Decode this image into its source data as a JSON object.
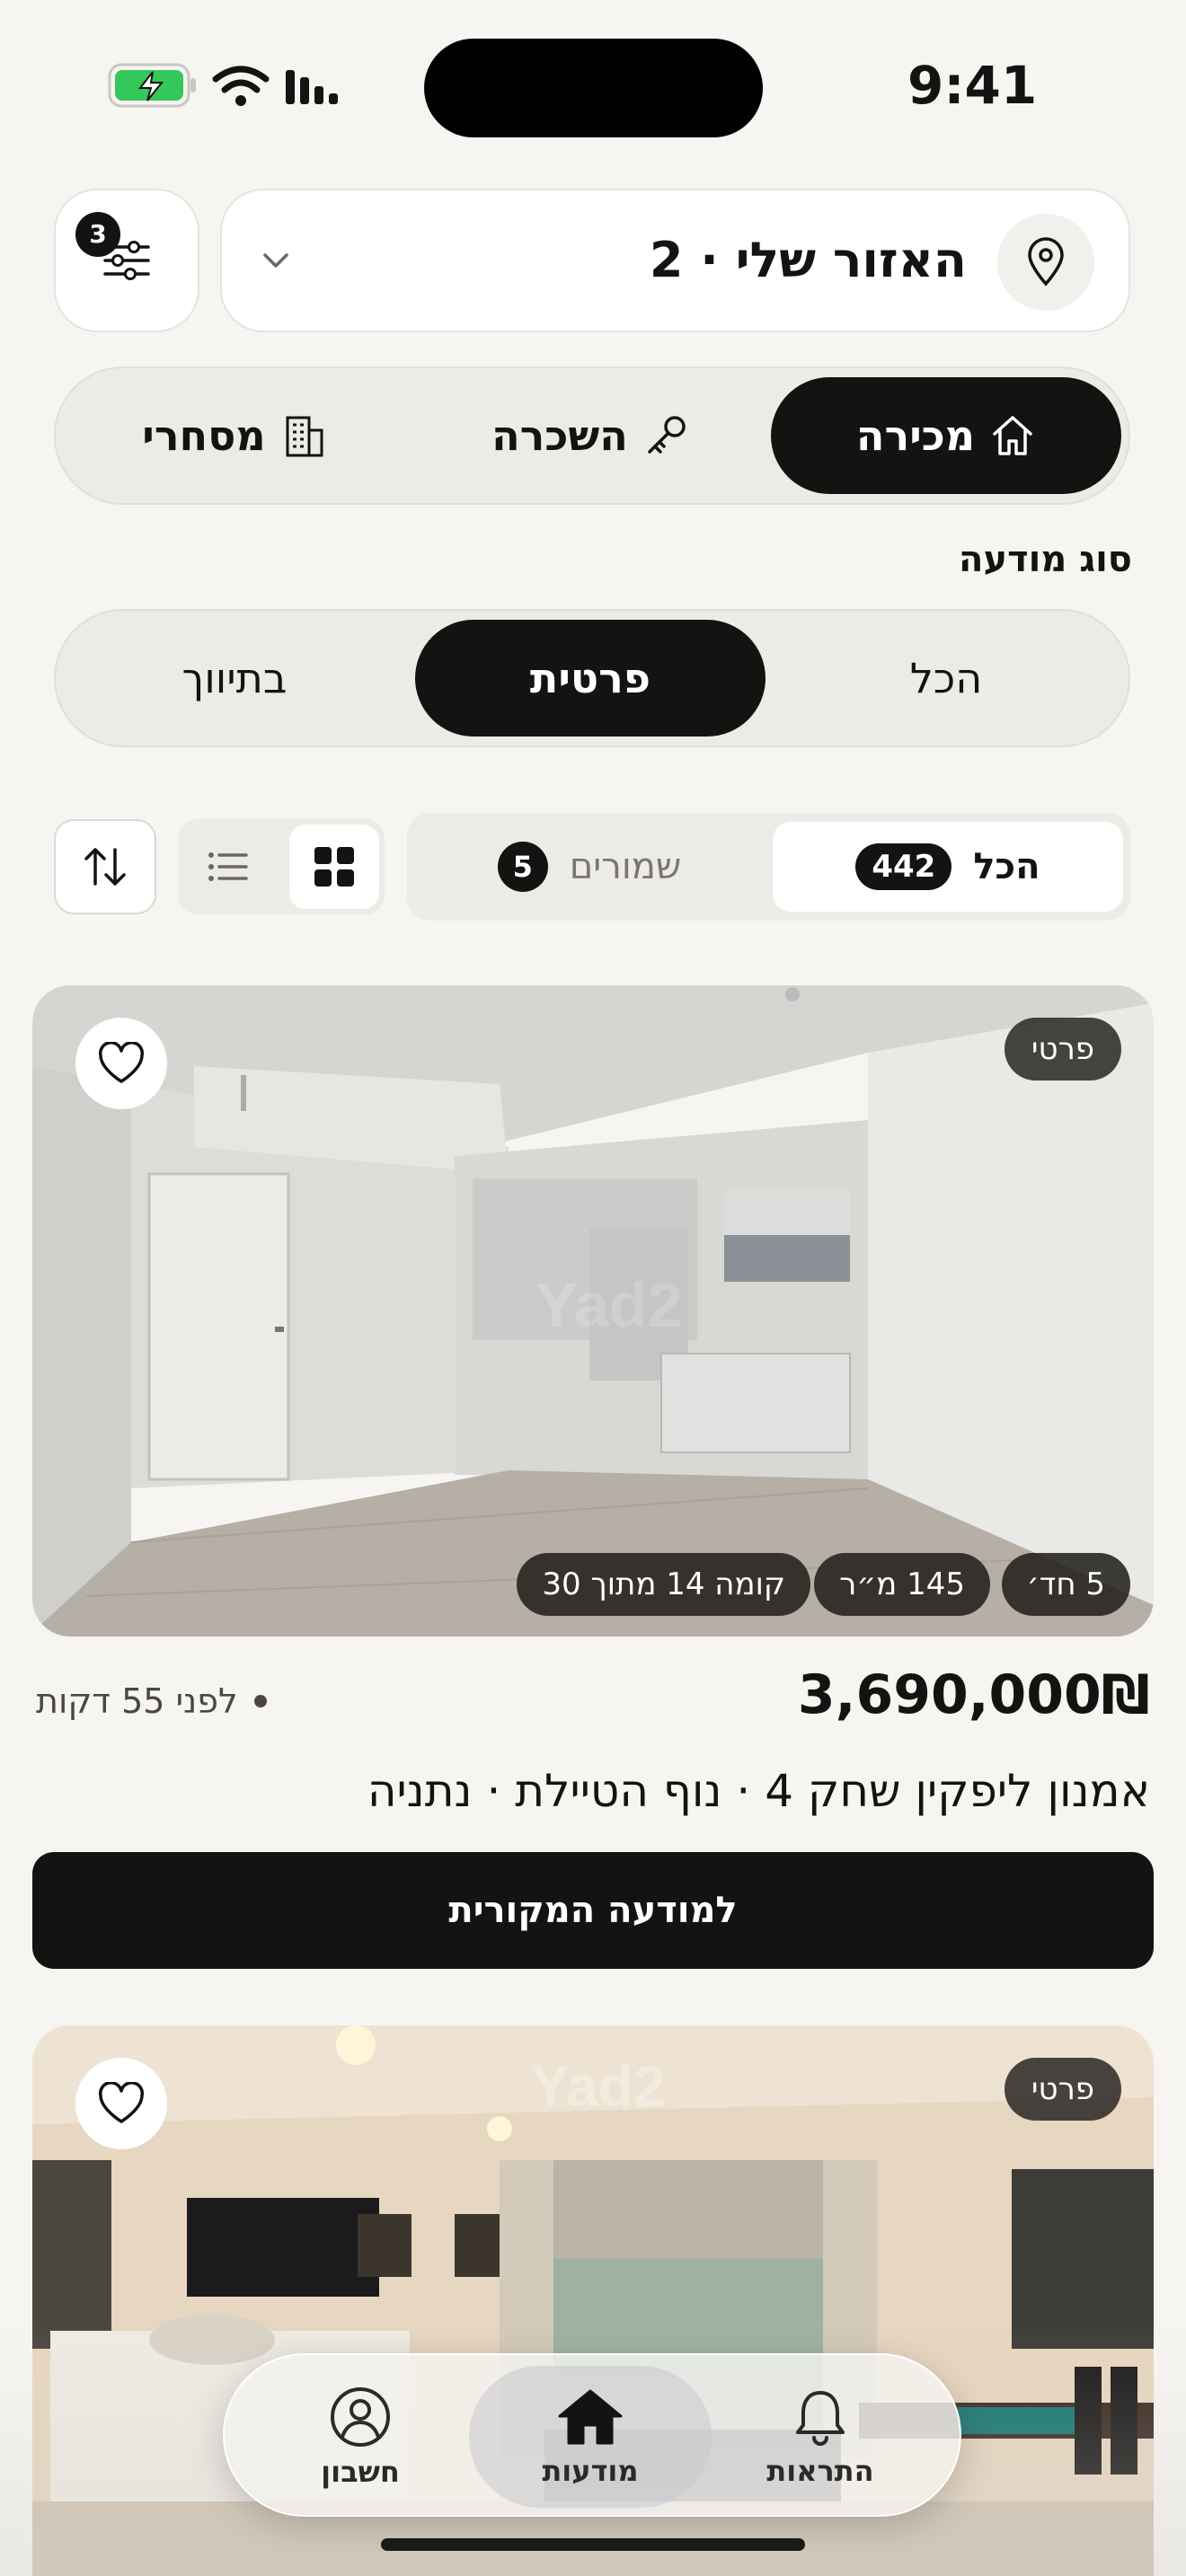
{
  "status_bar": {
    "time": "9:41"
  },
  "search": {
    "location_text": "האזור שלי · 2",
    "filter_count": "3"
  },
  "deal_types": [
    {
      "label": "מכירה",
      "icon": "home-icon",
      "active": true
    },
    {
      "label": "השכרה",
      "icon": "key-icon",
      "active": false
    },
    {
      "label": "מסחרי",
      "icon": "building-icon",
      "active": false
    }
  ],
  "ad_type": {
    "label": "סוג מודעה",
    "options": [
      {
        "label": "הכל",
        "active": false
      },
      {
        "label": "פרטית",
        "active": true
      },
      {
        "label": "בתיווך",
        "active": false
      }
    ]
  },
  "result_tabs": {
    "all_label": "הכל",
    "all_count": "442",
    "saved_label": "שמורים",
    "saved_count": "5"
  },
  "view_mode": "grid",
  "listings": [
    {
      "tag": "פרטי",
      "chips": {
        "rooms": "5 חד׳",
        "area": "145 מ״ר",
        "floor": "קומה 14 מתוך 30"
      },
      "price": "3,690,000₪",
      "time_ago": "לפני 55 דקות",
      "address": "אמנון ליפקין שחק 4 · נוף הטיילת · נתניה",
      "cta": "למודעה המקורית",
      "watermark": "Yad2"
    },
    {
      "tag": "פרטי",
      "watermark": "Yad2"
    }
  ],
  "bottom_nav": [
    {
      "label": "התראות",
      "icon": "bell-icon",
      "active": false
    },
    {
      "label": "מודעות",
      "icon": "home-filled-icon",
      "active": true
    },
    {
      "label": "חשבון",
      "icon": "account-icon",
      "active": false
    }
  ],
  "colors": {
    "primary": "#141311",
    "background": "#f6f5f2",
    "battery": "#34c759"
  }
}
